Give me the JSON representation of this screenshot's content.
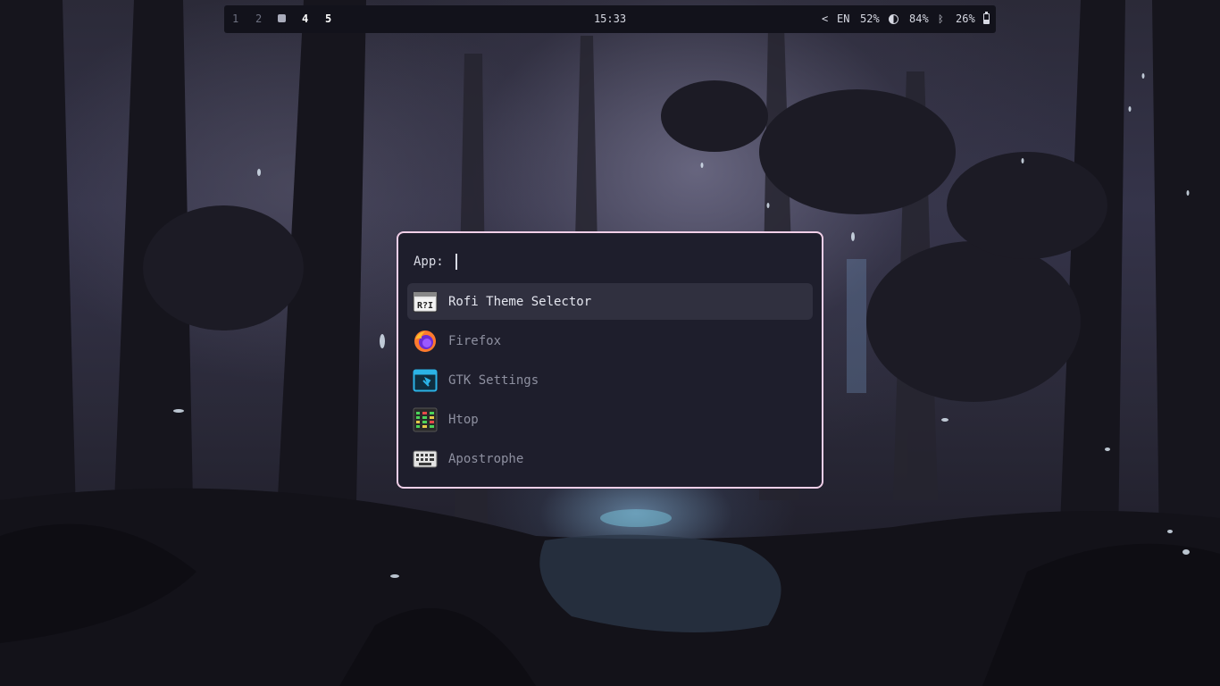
{
  "topbar": {
    "workspaces": [
      "1",
      "2",
      "4",
      "5"
    ],
    "clock": "15:33",
    "tray_arrow": "<",
    "keyboard_layout": "EN",
    "brightness": "52%",
    "bluetooth_battery": "84%",
    "battery": "26%",
    "icons": [
      "brightness-icon",
      "bluetooth-icon",
      "battery-icon"
    ]
  },
  "launcher": {
    "prompt": "App:",
    "input_value": "",
    "border_color": "#f1cfe8",
    "items": [
      {
        "label": "Rofi Theme Selector",
        "icon": "rofi-icon",
        "selected": true
      },
      {
        "label": "Firefox",
        "icon": "firefox-icon",
        "selected": false
      },
      {
        "label": "GTK Settings",
        "icon": "gtk-settings-icon",
        "selected": false
      },
      {
        "label": "Htop",
        "icon": "htop-icon",
        "selected": false
      },
      {
        "label": "Apostrophe",
        "icon": "keyboard-icon",
        "selected": false
      }
    ]
  }
}
